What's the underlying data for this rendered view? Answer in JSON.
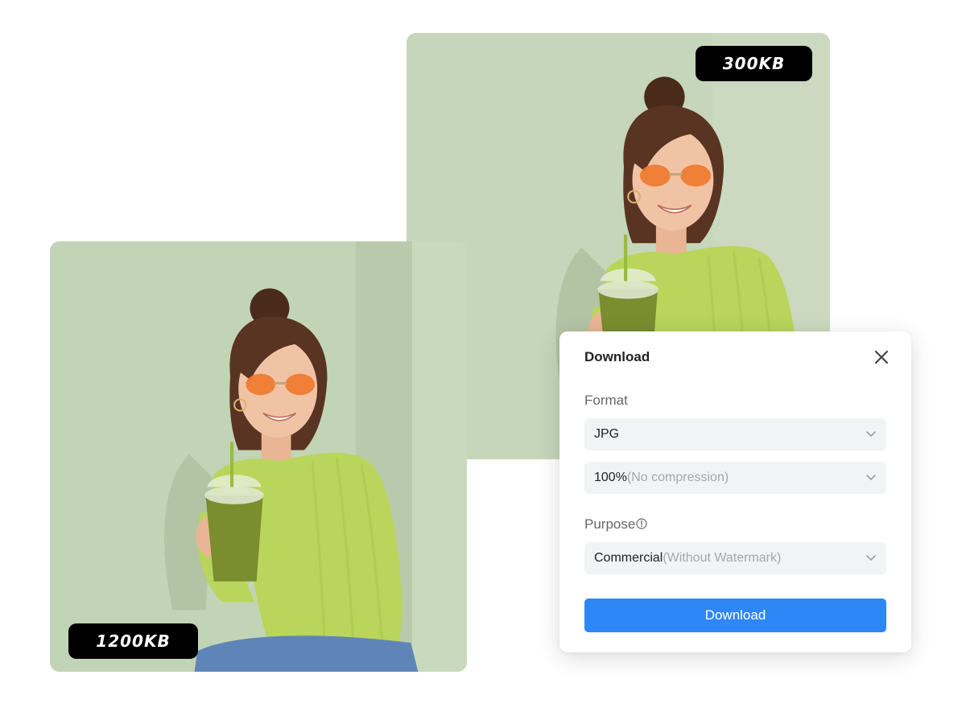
{
  "images": {
    "compressed": {
      "size_label": "300KB"
    },
    "original": {
      "size_label": "1200KB"
    }
  },
  "dialog": {
    "title": "Download",
    "close_icon": "close-icon",
    "format": {
      "label": "Format",
      "selected": "JPG"
    },
    "quality": {
      "value": "100%",
      "hint": "(No compression)"
    },
    "purpose": {
      "label": "Purpose",
      "info_icon": "info-icon",
      "value": "Commercial",
      "hint": "(Without Watermark)"
    },
    "download_button_label": "Download"
  },
  "colors": {
    "photo_background": "#c4d6b8",
    "sweater": "#b9d55c",
    "badge_background": "#000000",
    "button_primary": "#2f86f7",
    "select_background": "#f2f3f5"
  }
}
